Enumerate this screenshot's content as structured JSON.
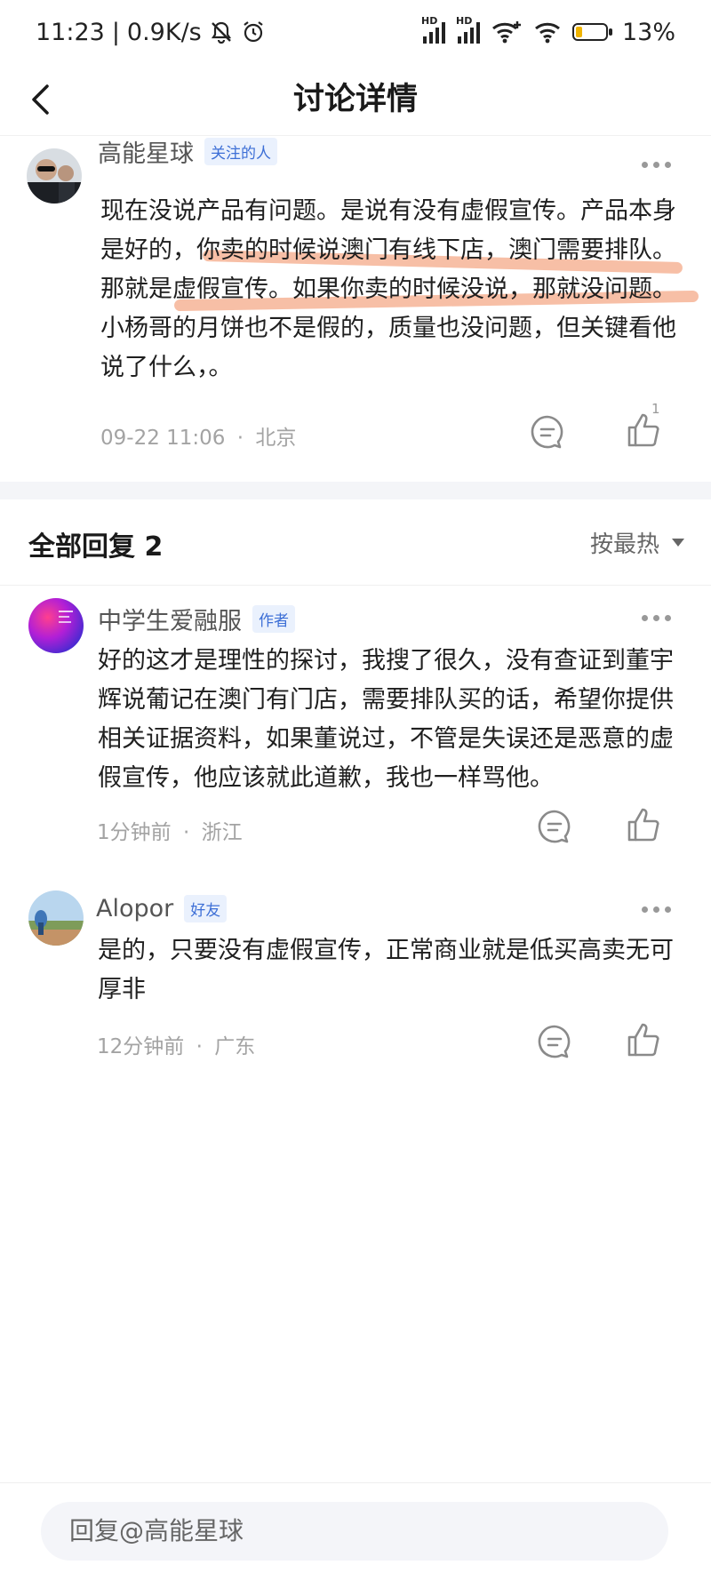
{
  "status_bar": {
    "time": "11:23",
    "net_speed": "0.9K/s",
    "battery_percent": "13%",
    "battery_level": 0.13,
    "icons": [
      "mute-bell-icon",
      "alarm-icon",
      "hd-signal-icon",
      "hd-signal-icon",
      "wifi-plus-icon",
      "wifi-icon",
      "battery-icon"
    ]
  },
  "nav": {
    "title": "讨论详情"
  },
  "post": {
    "author": "高能星球",
    "tag": "关注的人",
    "content": "现在没说产品有问题。是说有没有虚假宣传。产品本身是好的，你卖的时候说澳门有线下店，澳门需要排队。那就是虚假宣传。如果你卖的时候没说，那就没问题。小杨哥的月饼也不是假的，质量也没问题，但关键看他说了什么，。",
    "timestamp": "09-22 11:06",
    "location": "北京",
    "like_count": "1"
  },
  "replies_header": {
    "title": "全部回复 2",
    "sort": "按最热"
  },
  "replies": [
    {
      "author": "中学生爱融服",
      "tag": "作者",
      "content": "好的这才是理性的探讨，我搜了很久，没有查证到董宇辉说葡记在澳门有门店，需要排队买的话，希望你提供相关证据资料，如果董说过，不管是失误还是恶意的虚假宣传，他应该就此道歉，我也一样骂他。",
      "timestamp": "1分钟前",
      "location": "浙江"
    },
    {
      "author": "Alopor",
      "tag": "好友",
      "content": "是的，只要没有虚假宣传，正常商业就是低买高卖无可厚非",
      "timestamp": "12分钟前",
      "location": "广东"
    }
  ],
  "meta_separator": "·",
  "reply_input": {
    "placeholder": "回复@高能星球"
  },
  "colors": {
    "tag_text": "#3d6fd6",
    "tag_bg": "#eaf1fd",
    "highlight": "#f08a5d",
    "battery": "#f0b400"
  }
}
